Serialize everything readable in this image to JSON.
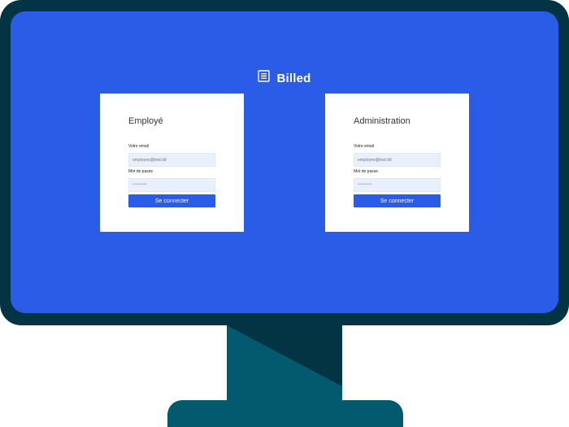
{
  "brand": {
    "title": "Billed",
    "icon": "document-list-icon"
  },
  "employee_card": {
    "title": "Employé",
    "email_label": "Votre email",
    "email_placeholder": "employee@test.tld",
    "password_label": "Mot de passe",
    "password_value": "••••••••",
    "submit_label": "Se connecter"
  },
  "admin_card": {
    "title": "Administration",
    "email_label": "Votre email",
    "email_placeholder": "employee@test.tld",
    "password_label": "Mot de passe",
    "password_value": "••••••••",
    "submit_label": "Se connecter"
  },
  "colors": {
    "screen_blue": "#2b5ce8",
    "frame": "#023443",
    "stand": "#03596e",
    "card": "#ffffff"
  }
}
